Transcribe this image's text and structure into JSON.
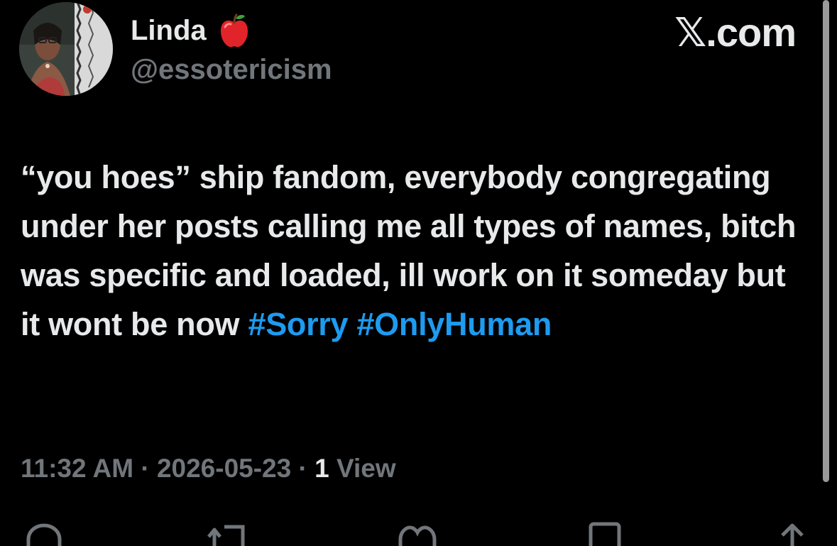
{
  "user": {
    "display_name": "Linda",
    "name_emoji": "red-apple-icon",
    "handle": "@essotericism"
  },
  "brand": "𝕏.com",
  "tweet": {
    "text_prefix": "“you hoes” ship fandom, everybody congregating under her posts calling me all types of names, bitch was specific and loaded, ill work on it someday but it wont be now ",
    "hashtag_1": "#Sorry",
    "hashtag_2": "#OnlyHuman"
  },
  "meta": {
    "time": "11:32 AM",
    "separator": " · ",
    "date": "2026-05-23",
    "views_count": "1",
    "views_label": " View"
  },
  "colors": {
    "background": "#000000",
    "text": "#e7e9ea",
    "muted": "#71767b",
    "hashtag": "#1d9bf0"
  }
}
